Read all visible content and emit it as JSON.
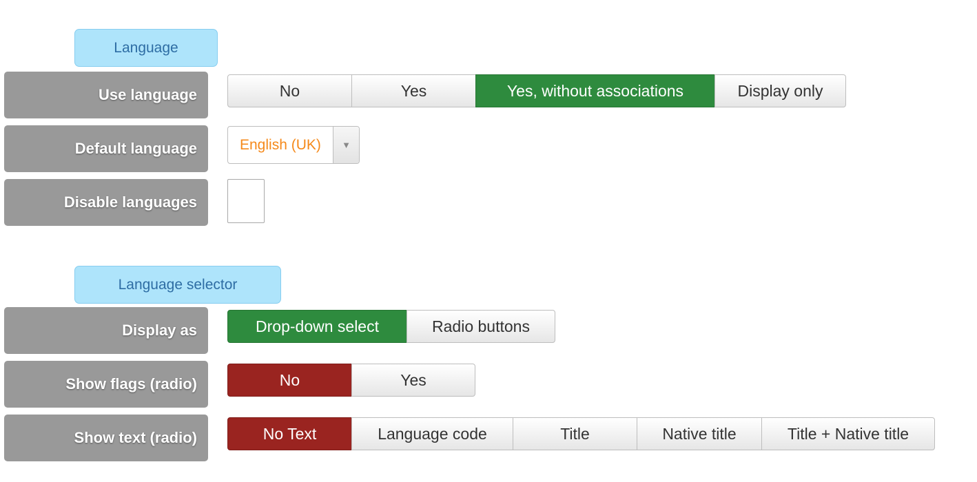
{
  "language_section": {
    "title": "Language",
    "use_language": {
      "label": "Use language",
      "options": [
        "No",
        "Yes",
        "Yes, without associations",
        "Display only"
      ],
      "selected": "Yes, without associations"
    },
    "default_language": {
      "label": "Default language",
      "value": "English (UK)",
      "caret_icon": "chevron-down-icon"
    },
    "disable_languages": {
      "label": "Disable languages",
      "checked": false
    }
  },
  "language_selector_section": {
    "title": "Language selector",
    "display_as": {
      "label": "Display as",
      "options": [
        "Drop-down select",
        "Radio buttons"
      ],
      "selected": "Drop-down select"
    },
    "show_flags": {
      "label": "Show flags (radio)",
      "options": [
        "No",
        "Yes"
      ],
      "selected": "No"
    },
    "show_text": {
      "label": "Show text (radio)",
      "options": [
        "No Text",
        "Language code",
        "Title",
        "Native title",
        "Title + Native title"
      ],
      "selected": "No Text"
    }
  },
  "colors": {
    "section_title_bg": "#aee4fb",
    "section_title_text": "#2e6da4",
    "label_bg": "#999999",
    "active_green": "#2e8b3e",
    "active_red": "#9a2420",
    "select_value_text": "#f5891a"
  }
}
